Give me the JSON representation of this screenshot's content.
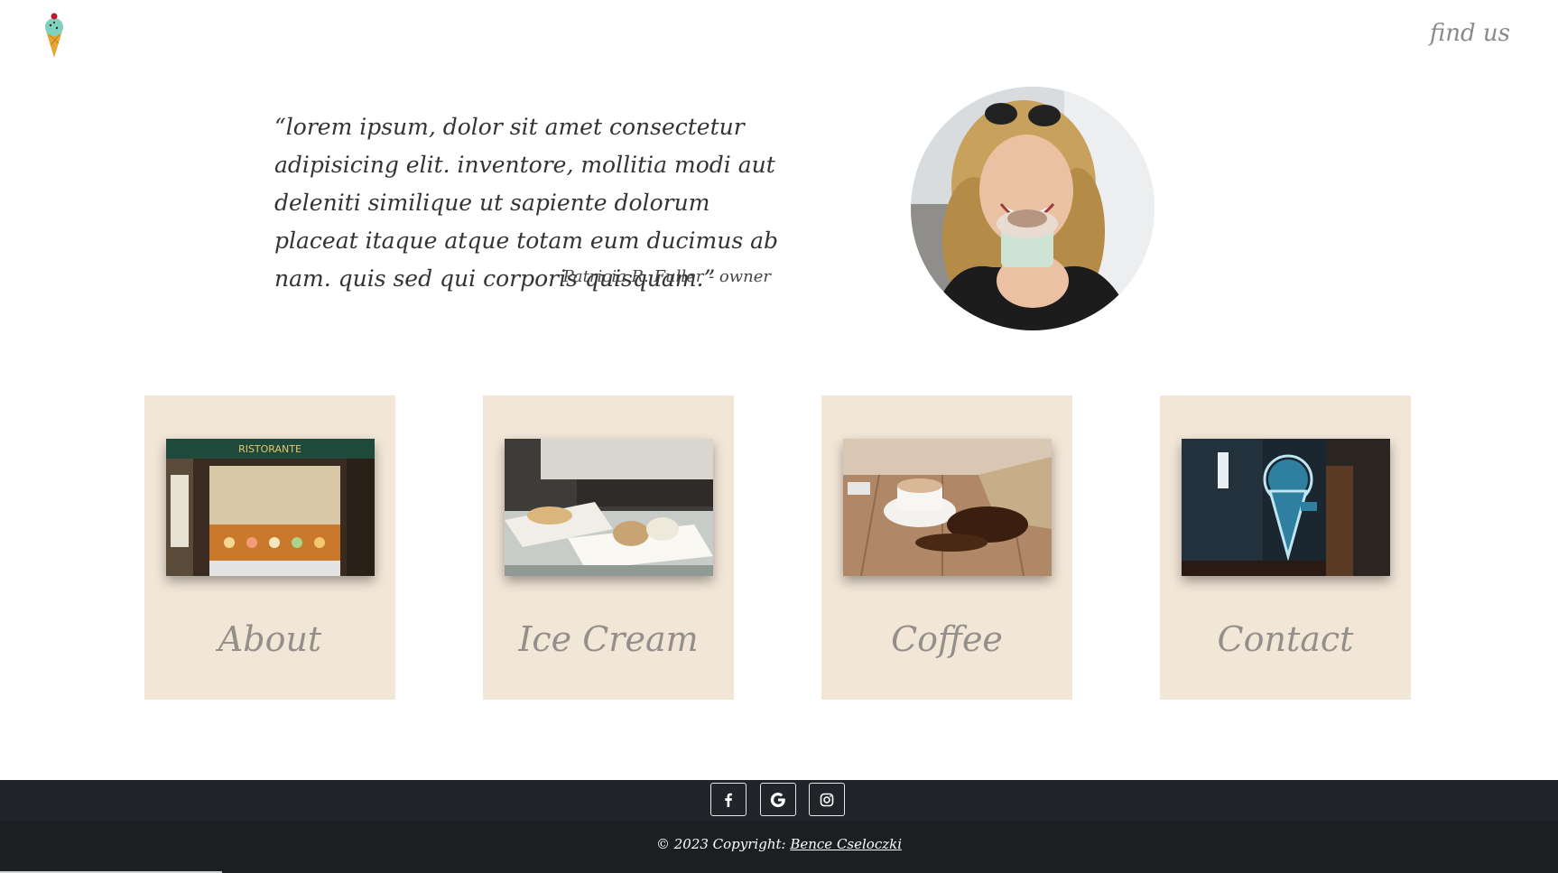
{
  "header": {
    "logo_icon": "ice-cream-cone-icon",
    "nav_link": "find us"
  },
  "testimonial": {
    "quote": "“lorem ipsum, dolor sit amet consectetur adipisicing elit. inventore, mollitia modi aut deleniti similique ut sapiente dolorum placeat itaque atque totam eum ducimus ab nam. quis sed qui corporis quisquam.”",
    "author": "Patricia R. Fuller - owner"
  },
  "cards": [
    {
      "label": "About"
    },
    {
      "label": "Ice Cream"
    },
    {
      "label": "Coffee"
    },
    {
      "label": "Contact"
    }
  ],
  "footer": {
    "social": [
      {
        "icon": "facebook-icon"
      },
      {
        "icon": "google-icon"
      },
      {
        "icon": "instagram-icon"
      }
    ],
    "copyright_prefix": "© 2023 Copyright: ",
    "copyright_name": "Bence Cseloczki"
  },
  "colors": {
    "card_bg": "#f2e6d7",
    "card_label": "#958f8c",
    "footer_bg": "#212529",
    "footer_text": "#ffffff"
  }
}
